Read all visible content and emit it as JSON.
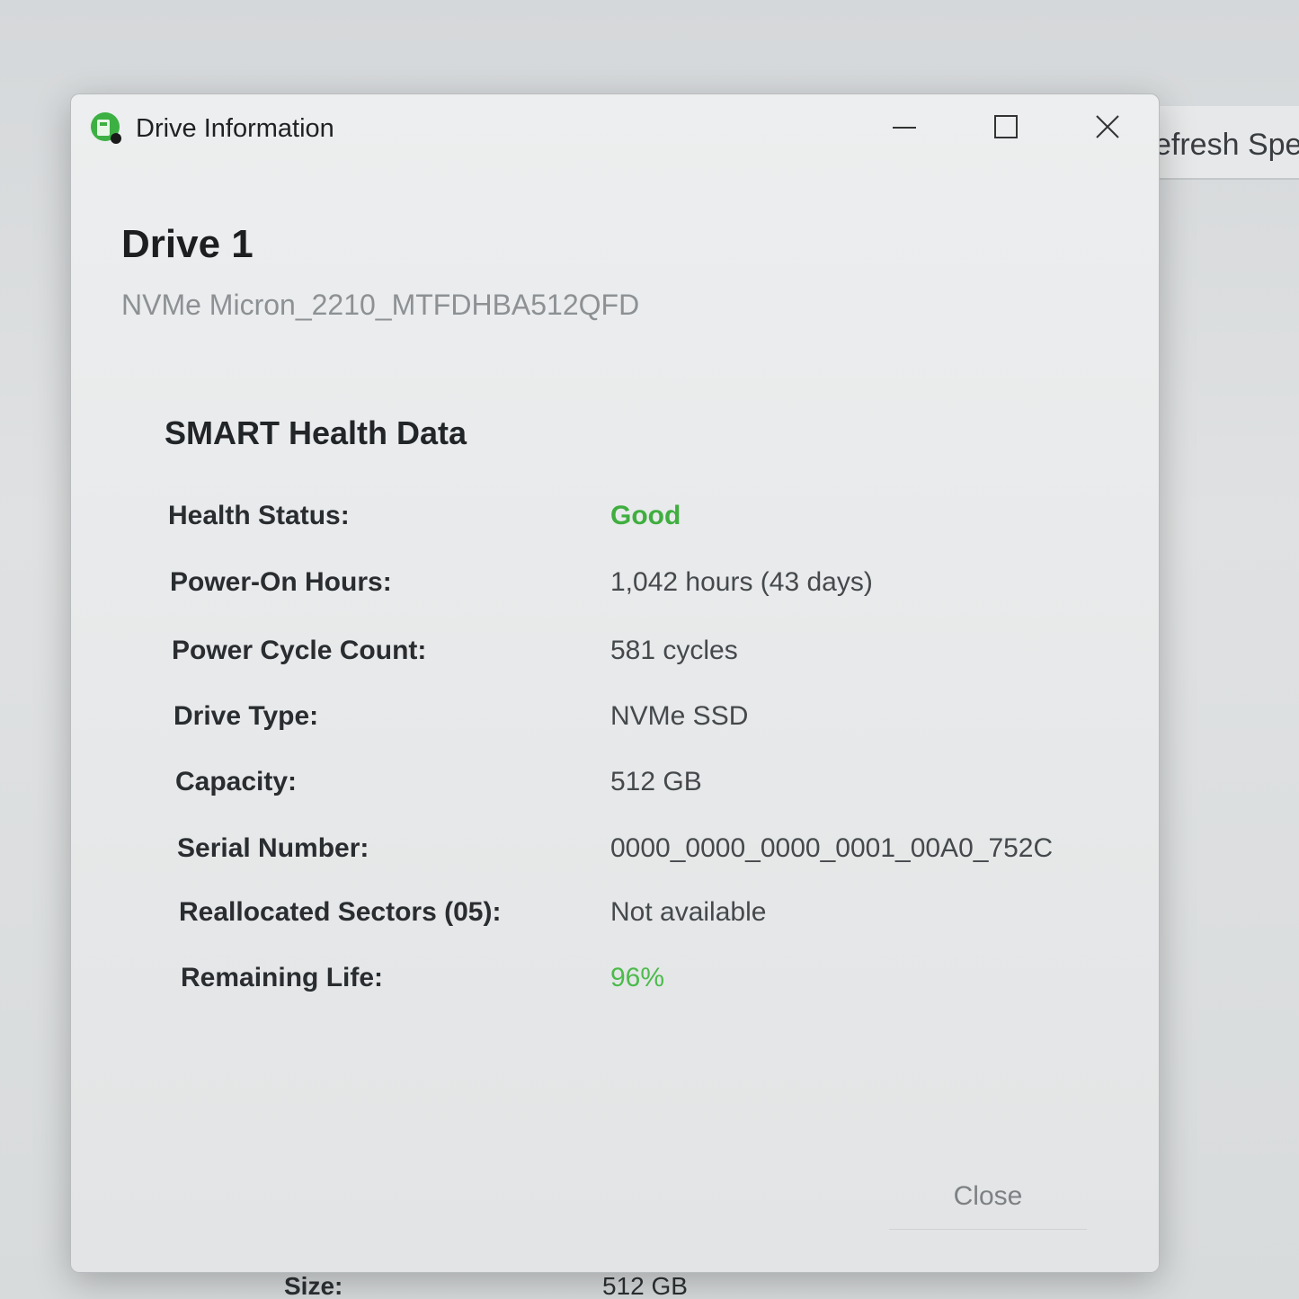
{
  "background": {
    "refresh_label": "efresh Spe",
    "size_label": "Size:",
    "size_value": "512 GB"
  },
  "window": {
    "title": "Drive Information",
    "icon": "drive-app-icon",
    "controls": {
      "minimize_icon": "minimize-icon",
      "maximize_icon": "maximize-icon",
      "close_icon": "close-icon"
    }
  },
  "drive": {
    "title": "Drive 1",
    "model": "NVMe Micron_2210_MTFDHBA512QFD"
  },
  "smart": {
    "section_title": "SMART Health Data",
    "rows": [
      {
        "label": "Health Status:",
        "value": "Good"
      },
      {
        "label": "Power-On Hours:",
        "value": "1,042 hours (43 days)"
      },
      {
        "label": "Power Cycle Count:",
        "value": "581 cycles"
      },
      {
        "label": "Drive Type:",
        "value": "NVMe SSD"
      },
      {
        "label": "Capacity:",
        "value": "512 GB"
      },
      {
        "label": "Serial Number:",
        "value": "0000_0000_0000_0001_00A0_752C"
      },
      {
        "label": "Reallocated Sectors (05):",
        "value": "Not available"
      },
      {
        "label": "Remaining Life:",
        "value": "96%"
      }
    ]
  },
  "footer": {
    "close_label": "Close"
  },
  "colors": {
    "good": "#3fae3f",
    "remaining_life": "#4cbb4c",
    "icon_green": "#3cb043"
  }
}
